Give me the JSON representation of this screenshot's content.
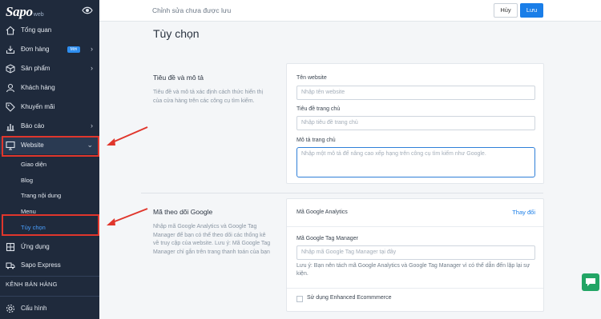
{
  "sidebar": {
    "logo": {
      "brand": "Sapo",
      "suffix": "web"
    },
    "items": [
      {
        "label": "Tổng quan"
      },
      {
        "label": "Đơn hàng",
        "badge": "Mới"
      },
      {
        "label": "Sản phẩm"
      },
      {
        "label": "Khách hàng"
      },
      {
        "label": "Khuyến mãi"
      },
      {
        "label": "Báo cáo"
      },
      {
        "label": "Website"
      },
      {
        "label": "Ứng dụng"
      },
      {
        "label": "Sapo Express"
      }
    ],
    "website_sub": [
      "Giao diện",
      "Blog",
      "Trang nội dung",
      "Menu",
      "Tùy chọn"
    ],
    "sales_channels_label": "KÊNH BÁN HÀNG",
    "settings_label": "Cấu hình"
  },
  "topbar": {
    "status": "Chỉnh sửa chưa được lưu",
    "cancel_label": "Hủy",
    "save_label": "Lưu"
  },
  "page": {
    "title": "Tùy chọn",
    "seo": {
      "title": "Tiêu đề và mô tả",
      "description": "Tiêu đề và mô tả xác định cách thức hiển thị của cửa hàng trên các công cụ tìm kiếm.",
      "fields": [
        {
          "label": "Tên website",
          "placeholder": "Nhập tên website"
        },
        {
          "label": "Tiêu đề trang chủ",
          "placeholder": "Nhập tiêu đề trang chủ"
        },
        {
          "label": "Mô tả trang chủ",
          "placeholder": "Nhập một mô tả để nâng cao xếp hạng trên công cụ tìm kiếm như Google."
        }
      ]
    },
    "google": {
      "title": "Mã theo dõi Google",
      "description": "Nhập mã Google Analytics và Google Tag Manager để bạn có thể theo dõi các thống kê về truy cập của website. Lưu ý: Mã Google Tag Manager chỉ gắn trên trang thanh toán của bạn",
      "analytics_label": "Mã Google Analytics",
      "change_label": "Thay đổi",
      "gtm_label": "Mã Google Tag Manager",
      "gtm_placeholder": "Nhập mã Google Tag Manager tại đây",
      "note": "Lưu ý: Bạn nên tách mã Google Analytics và Google Tag Manager vì có thể dẫn đến lặp lại sự kiện.",
      "ecommerce_label": "Sử dụng Enhanced Ecommmerce"
    }
  },
  "colors": {
    "sidebar_bg": "#1f2a3c",
    "accent": "#1a7ee8",
    "highlight": "#e0362c",
    "chat": "#22a565"
  }
}
